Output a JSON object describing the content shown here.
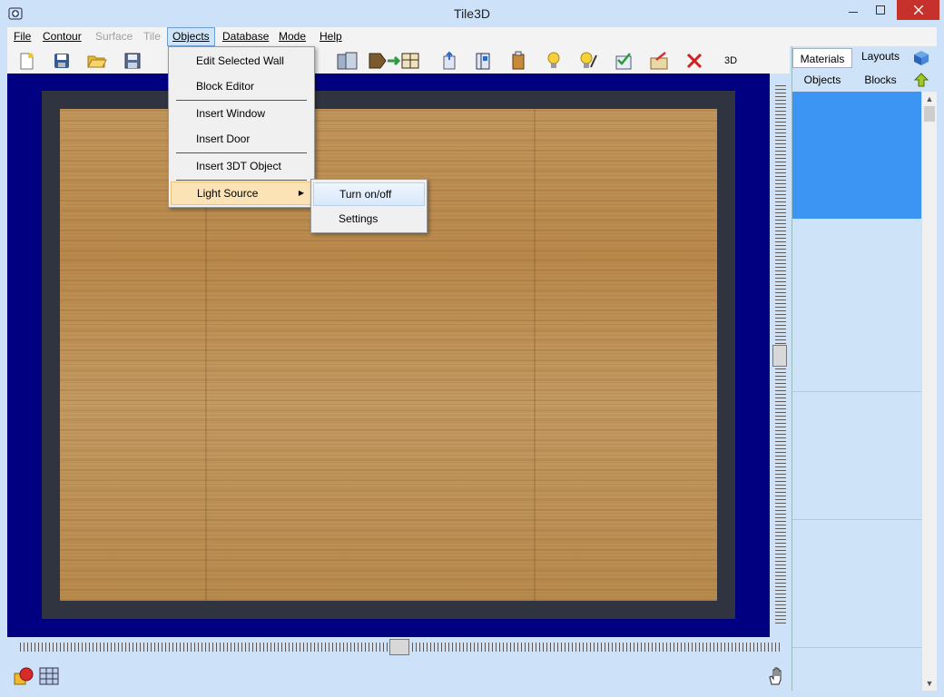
{
  "window": {
    "title": "Tile3D"
  },
  "menubar": [
    {
      "label": "File",
      "disabled": false
    },
    {
      "label": "Contour",
      "disabled": false
    },
    {
      "label": "Surface",
      "disabled": true
    },
    {
      "label": "Tile",
      "disabled": true
    },
    {
      "label": "Objects",
      "disabled": false,
      "active": true
    },
    {
      "label": "Database",
      "disabled": false
    },
    {
      "label": "Mode",
      "disabled": false
    },
    {
      "label": "Help",
      "disabled": false
    }
  ],
  "toolbar": {
    "view_3d_label": "3D",
    "icons": [
      "new-document-icon",
      "save-database-icon",
      "open-folder-icon",
      "save-disk-icon",
      "insert-door-icon",
      "move-object-icon",
      "export-icon",
      "edit-object-icon",
      "object-properties-icon",
      "light-icon",
      "light-settings-icon",
      "check-list-icon",
      "edit-sheet-icon",
      "delete-icon"
    ]
  },
  "objects_menu": {
    "items": [
      {
        "label": "Edit Selected Wall"
      },
      {
        "label": "Block Editor"
      },
      {
        "label": "Insert Window"
      },
      {
        "label": "Insert Door"
      },
      {
        "label": "Insert 3DT Object"
      },
      {
        "label": "Light Source",
        "has_submenu": true,
        "highlighted": true
      }
    ]
  },
  "light_submenu": {
    "items": [
      {
        "label": "Turn on/off",
        "highlighted": true
      },
      {
        "label": "Settings"
      }
    ]
  },
  "panel": {
    "tabs_top": [
      "Materials",
      "Layouts"
    ],
    "tabs_bottom": [
      "Objects",
      "Blocks"
    ],
    "selected_color": "#3c95f2"
  },
  "colors": {
    "canvas_bg": "#000080",
    "wall": "#2f3440",
    "floor_wood": "#c1965c",
    "close_button": "#c7312b"
  }
}
